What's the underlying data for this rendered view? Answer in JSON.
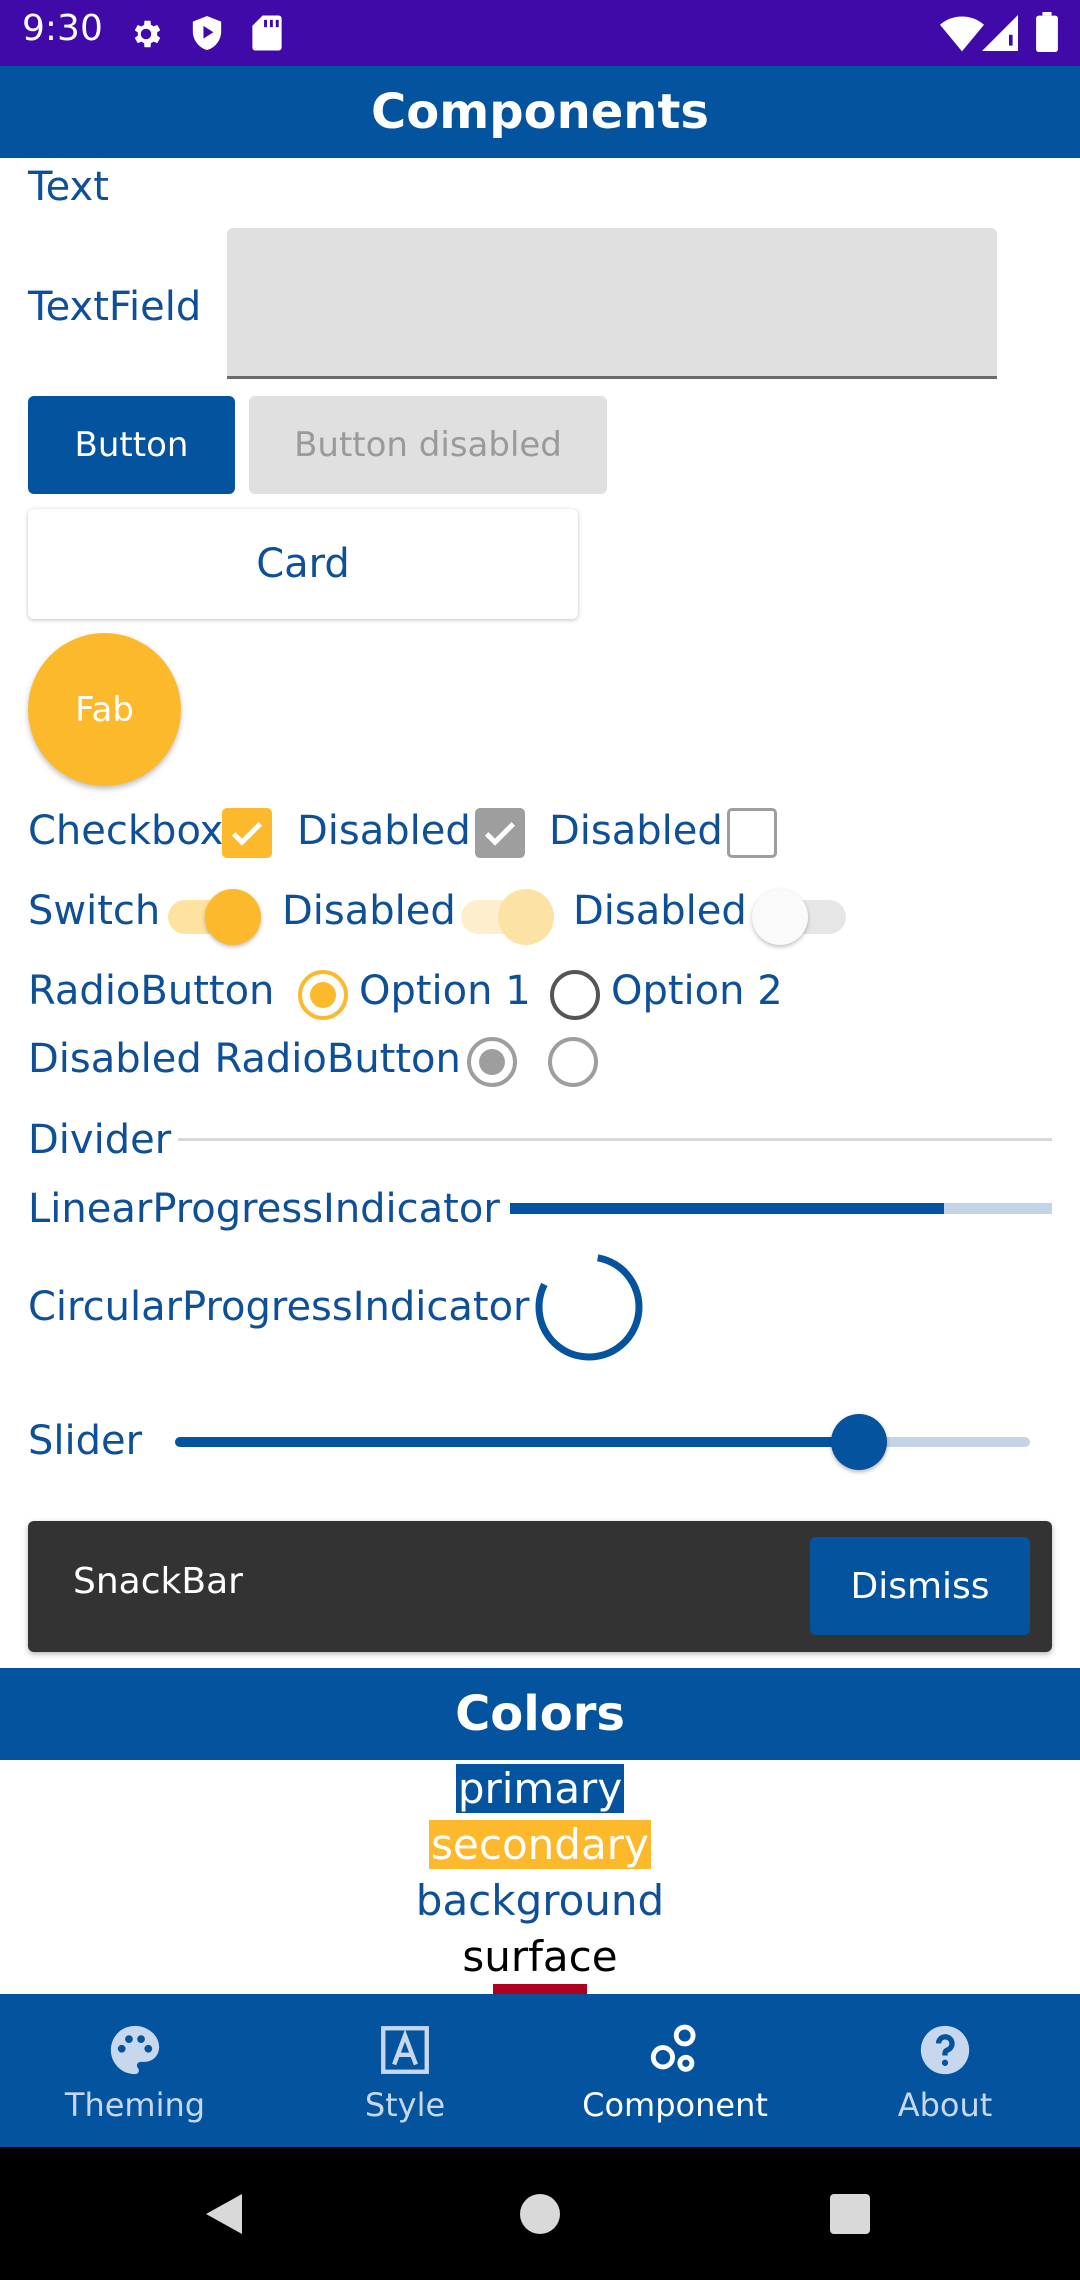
{
  "status_bar": {
    "time": "9:30"
  },
  "app_bar": {
    "title": "Components"
  },
  "components": {
    "text_label": "Text",
    "textfield_label": "TextField",
    "textfield_value": "",
    "button_label": "Button",
    "button_disabled_label": "Button disabled",
    "card_label": "Card",
    "fab_label": "Fab",
    "checkbox": {
      "label": "Checkbox",
      "checked": true,
      "disabled_checked_label": "Disabled",
      "disabled_unchecked_label": "Disabled"
    },
    "switch": {
      "label": "Switch",
      "on": true,
      "disabled_on_label": "Disabled",
      "disabled_off_label": "Disabled"
    },
    "radio": {
      "label": "RadioButton",
      "option1": "Option 1",
      "option2": "Option 2",
      "selected": "Option 1",
      "disabled_label": "Disabled RadioButton"
    },
    "divider_label": "Divider",
    "linear_progress": {
      "label": "LinearProgressIndicator",
      "value": 0.8
    },
    "circular_progress": {
      "label": "CircularProgressIndicator"
    },
    "slider": {
      "label": "Slider",
      "value": 0.8
    },
    "snackbar": {
      "text": "SnackBar",
      "action": "Dismiss"
    }
  },
  "colors_section": {
    "title": "Colors",
    "swatches": [
      {
        "name": "primary",
        "background": "#03539f",
        "text_color": "#ffffff"
      },
      {
        "name": "secondary",
        "background": "#fcb92c",
        "text_color": "#ffffff"
      },
      {
        "name": "background",
        "background": "#ffffff",
        "text_color": "#0d4f98"
      },
      {
        "name": "surface",
        "background": "#ffffff",
        "text_color": "#000000"
      }
    ],
    "error_color": "#b00020"
  },
  "theme": {
    "primary": "#03539f",
    "secondary": "#fcb92c",
    "status_bar": "#3f0aa8"
  },
  "bottom_nav": {
    "items": [
      {
        "label": "Theming",
        "icon": "palette-icon",
        "active": false
      },
      {
        "label": "Style",
        "icon": "text-style-icon",
        "active": false
      },
      {
        "label": "Component",
        "icon": "bubbles-icon",
        "active": true
      },
      {
        "label": "About",
        "icon": "help-icon",
        "active": false
      }
    ]
  }
}
